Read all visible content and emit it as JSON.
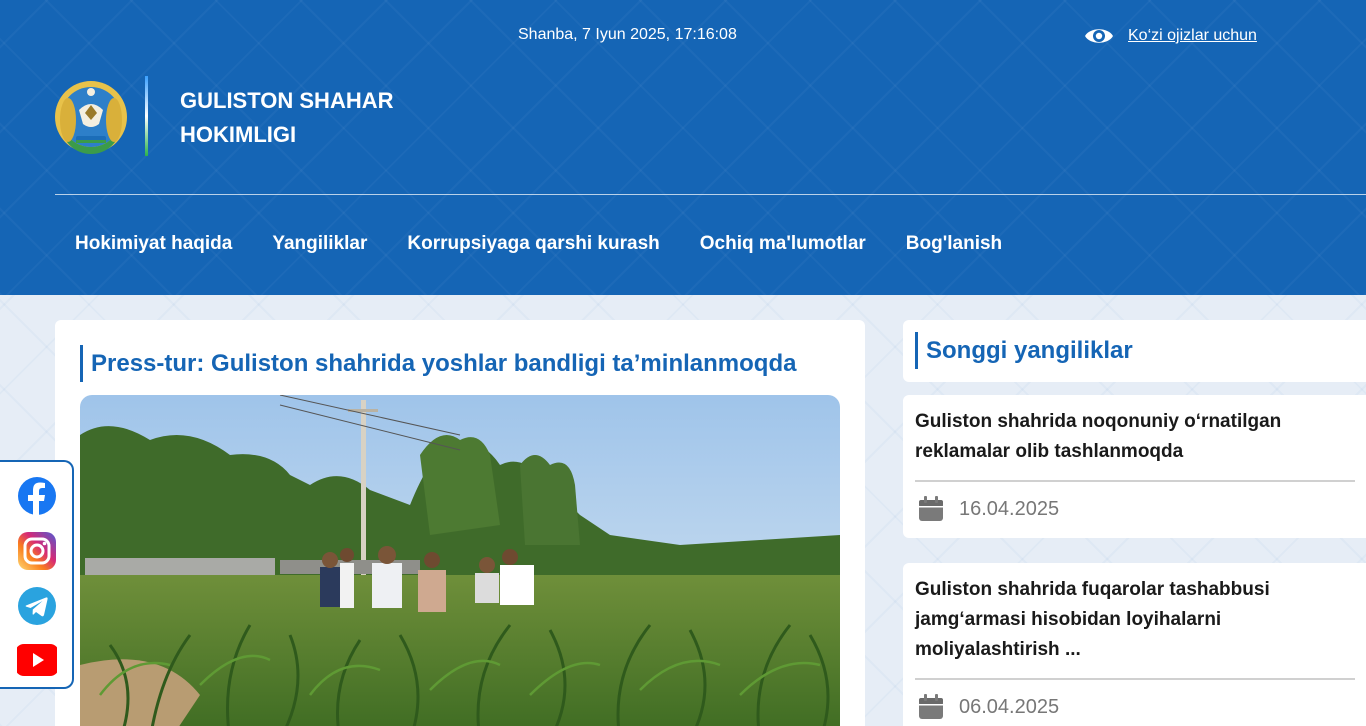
{
  "header": {
    "datetime": "Shanba, 7 Iyun 2025, 17:16:08",
    "accessibility_label": "Ko‘zi ojizlar uchun",
    "org_title_line1": "GULISTON SHAHAR",
    "org_title_line2": "HOKIMLIGI",
    "icons": {
      "accessibility": "eye-icon",
      "logo": "state-emblem-icon"
    }
  },
  "nav": {
    "items": [
      {
        "label": "Hokimiyat haqida"
      },
      {
        "label": "Yangiliklar"
      },
      {
        "label": "Korrupsiyaga qarshi kurash"
      },
      {
        "label": "Ochiq ma'lumotlar"
      },
      {
        "label": "Bog'lanish"
      }
    ]
  },
  "article": {
    "title": "Press-tur: Guliston shahrida yoshlar bandligi ta’minlanmoqda",
    "image_icon": "field-photo"
  },
  "sidebar": {
    "heading": "Songgi yangiliklar",
    "news": [
      {
        "title": "Guliston shahrida noqonuniy o‘rnatilgan reklamalar olib tashlanmoqda",
        "date": "16.04.2025"
      },
      {
        "title": "Guliston shahrida fuqarolar tashabbusi jamg‘armasi hisobidan loyihalarni moliyalashtirish ...",
        "date": "06.04.2025"
      }
    ],
    "date_icon": "calendar-icon"
  },
  "social": {
    "items": [
      {
        "icon": "facebook-icon",
        "color": "#1877f2"
      },
      {
        "icon": "instagram-icon",
        "color": "#e1306c"
      },
      {
        "icon": "telegram-icon",
        "color": "#2aa3df"
      },
      {
        "icon": "youtube-icon",
        "color": "#ff0000"
      }
    ]
  },
  "colors": {
    "brand": "#1565b5",
    "page_bg": "#e6edf6",
    "text": "#1a1a1a",
    "muted": "#777777"
  }
}
